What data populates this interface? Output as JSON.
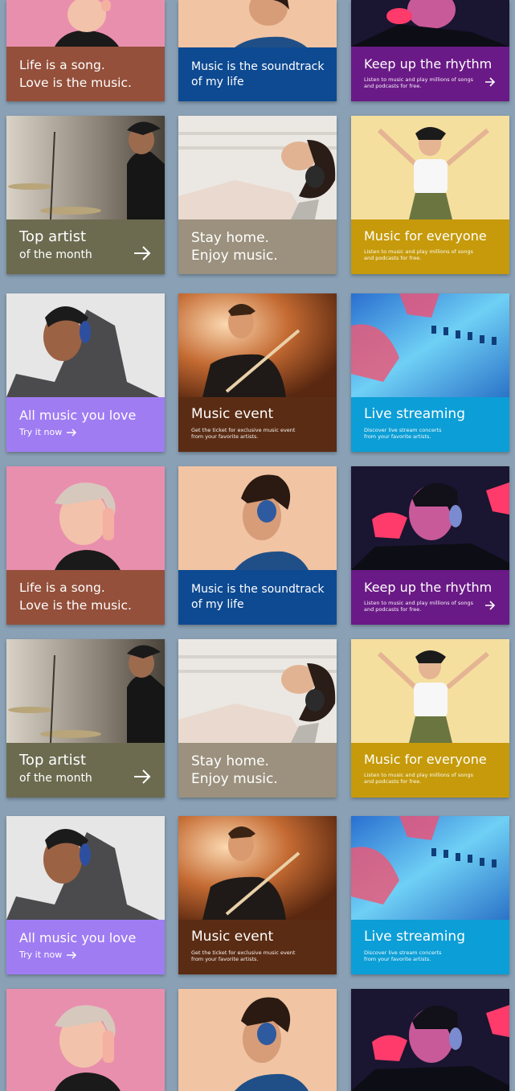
{
  "colors": {
    "background": "#8aa0b5",
    "rust": "#94503b",
    "navy": "#0e4a92",
    "purple": "#6a1a86",
    "olive": "#6c6b50",
    "taupe": "#9b917e",
    "mustard": "#c69a0a",
    "lavender": "#a07cf3",
    "brown": "#5b2c14",
    "cyan": "#0c9ed6"
  },
  "cards": {
    "song": {
      "line1": "Life is a song.",
      "line2": "Love is the music."
    },
    "soundtrack": {
      "line1": "Music is the soundtrack",
      "line2": "of my life"
    },
    "rhythm": {
      "title": "Keep up the rhythm",
      "body": "Listen to music and play millions of songs\nand podcasts for free."
    },
    "top_artist": {
      "title": "Top artist",
      "subtitle": "of the month"
    },
    "stay_home": {
      "line1": "Stay home.",
      "line2": "Enjoy music."
    },
    "everyone": {
      "title": "Music for everyone",
      "body": "Listen to music and play millions of songs\nand podcasts for free."
    },
    "all_music": {
      "title": "All music you love",
      "cta": "Try it now"
    },
    "event": {
      "title": "Music event",
      "body": "Get the ticket for exclusive music event\nfrom your favorite artists."
    },
    "streaming": {
      "title": "Live streaming",
      "body": "Discover live stream concerts\nfrom your favorite artists."
    }
  },
  "icons": [
    "arrow-right-icon"
  ]
}
